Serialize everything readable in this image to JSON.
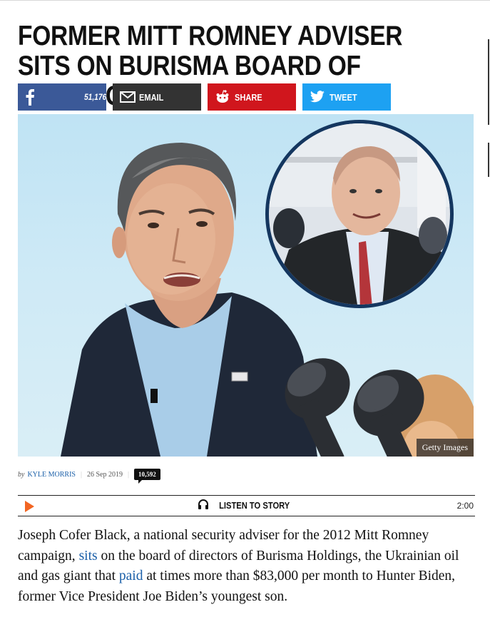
{
  "article": {
    "headline": "FORMER MITT ROMNEY ADVISER SITS ON BURISMA BOARD OF DIRECTORS"
  },
  "share": {
    "facebook_count": "51,176",
    "email_label": "EMAIL",
    "share_label": "SHARE",
    "tweet_label": "TWEET",
    "colors": {
      "facebook": "#3b5998",
      "email": "#333333",
      "reddit": "#d0161d",
      "twitter": "#1da1f2"
    },
    "icons": [
      "facebook-icon",
      "envelope-icon",
      "reddit-icon",
      "twitter-bird-icon"
    ]
  },
  "image": {
    "credit": "Getty Images"
  },
  "byline": {
    "by": "by",
    "author": "KYLE MORRIS",
    "date": "26 Sep 2019",
    "comments": "10,592"
  },
  "listen": {
    "title": "LISTEN TO STORY",
    "duration": "2:00",
    "icons": [
      "play-icon",
      "headphones-icon"
    ],
    "accent": "#f26522"
  },
  "body": {
    "p1_a": "Joseph Cofer Black, a national security adviser for the 2012 Mitt Romney campaign, ",
    "link1": "sits",
    "p1_b": " on the board of directors of Burisma Holdings, the Ukrainian oil and gas giant that ",
    "link2": "paid",
    "p1_c": " at times more than $83,000 per month to Hunter Biden, former Vice President Joe Biden’s youngest son.",
    "link_color": "#1a5fa8"
  }
}
